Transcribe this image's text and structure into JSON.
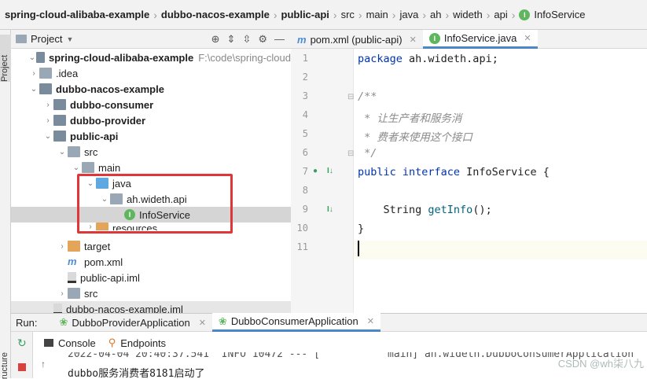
{
  "breadcrumb": [
    "spring-cloud-alibaba-example",
    "dubbo-nacos-example",
    "public-api",
    "src",
    "main",
    "java",
    "ah",
    "wideth",
    "api",
    "InfoService"
  ],
  "project_panel": {
    "title": "Project",
    "side_label": "Project"
  },
  "tree": [
    {
      "label": "spring-cloud-alibaba-example",
      "suffix": "F:\\code\\spring-cloud",
      "bold": true
    },
    {
      "label": ".idea"
    },
    {
      "label": "dubbo-nacos-example",
      "bold": true
    },
    {
      "label": "dubbo-consumer",
      "bold": true
    },
    {
      "label": "dubbo-provider",
      "bold": true
    },
    {
      "label": "public-api",
      "bold": true
    },
    {
      "label": "src"
    },
    {
      "label": "main"
    },
    {
      "label": "java"
    },
    {
      "label": "ah.wideth.api"
    },
    {
      "label": "InfoService"
    },
    {
      "label": "resources"
    },
    {
      "label": "target"
    },
    {
      "label": "pom.xml"
    },
    {
      "label": "public-api.iml"
    },
    {
      "label": "src"
    },
    {
      "label": "dubbo-nacos-example.iml"
    }
  ],
  "editor_tabs": [
    "pom.xml (public-api)",
    "InfoService.java"
  ],
  "code": {
    "line_numbers": [
      "1",
      "2",
      "3",
      "4",
      "5",
      "6",
      "7",
      "8",
      "9",
      "10",
      "11"
    ],
    "l1_kw": "package",
    "l1_rest": " ah.wideth.api;",
    "l3": "/**",
    "l4": " * 让生产者和服务消",
    "l5": " * 费者来使用这个接口",
    "l6": " */",
    "l7_kw": "public interface",
    "l7_rest": " InfoService {",
    "l9_type": "    String ",
    "l9_method": "getInfo",
    "l9_rest": "();",
    "l10": "}"
  },
  "run": {
    "label": "Run:",
    "tabs": [
      "DubboProviderApplication",
      "DubboConsumerApplication"
    ],
    "subtabs": [
      "Console",
      "Endpoints"
    ]
  },
  "console": {
    "line1": "2022-04-04 20:40:37.541  INFO 10472 --- [           main] ah.wideth.DubboConsumerApplication",
    "line2": "dubbo服务消费者8181启动了"
  },
  "left_bottom_label": "ructure",
  "watermark": "CSDN @wh柒八九",
  "colors": {
    "keyword": "#0033b3",
    "comment": "#8c8c8c",
    "method": "#00627a",
    "highlight_box": "#e0363a",
    "accent": "#4a88c7"
  }
}
